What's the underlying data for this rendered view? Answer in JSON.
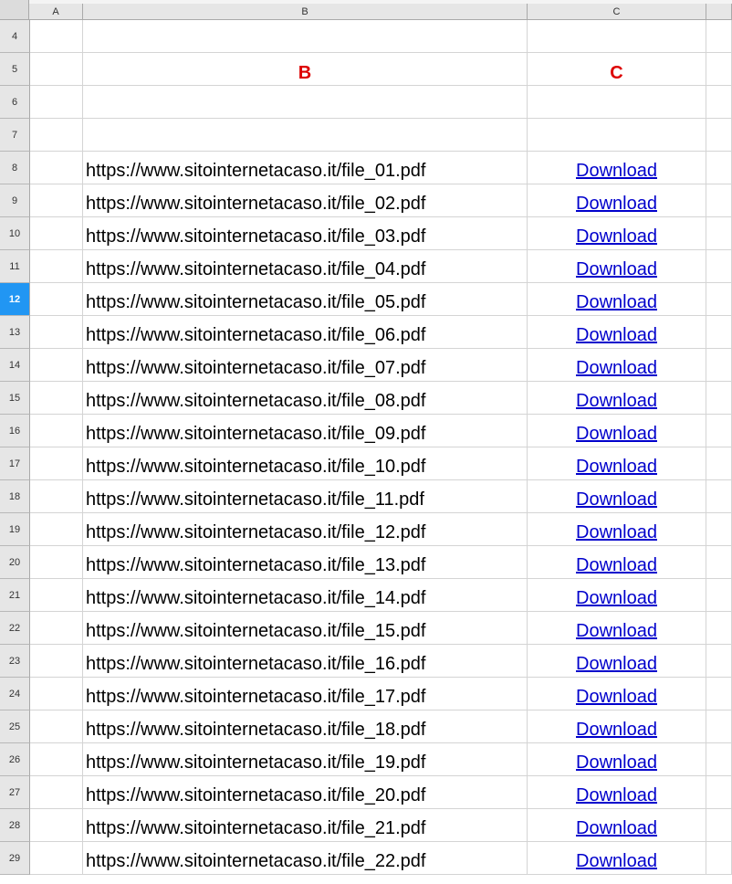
{
  "columns": [
    "A",
    "B",
    "C"
  ],
  "header_row": {
    "row": "5",
    "b": "B",
    "c": "C"
  },
  "empty_rows": [
    "4",
    "6",
    "7"
  ],
  "selected_row": "12",
  "rows": [
    {
      "row": "8",
      "url": "https://www.sitointernetacaso.it/file_01.pdf",
      "link": "Download"
    },
    {
      "row": "9",
      "url": "https://www.sitointernetacaso.it/file_02.pdf",
      "link": "Download"
    },
    {
      "row": "10",
      "url": "https://www.sitointernetacaso.it/file_03.pdf",
      "link": "Download"
    },
    {
      "row": "11",
      "url": "https://www.sitointernetacaso.it/file_04.pdf",
      "link": "Download"
    },
    {
      "row": "12",
      "url": "https://www.sitointernetacaso.it/file_05.pdf",
      "link": "Download"
    },
    {
      "row": "13",
      "url": "https://www.sitointernetacaso.it/file_06.pdf",
      "link": "Download"
    },
    {
      "row": "14",
      "url": "https://www.sitointernetacaso.it/file_07.pdf",
      "link": "Download"
    },
    {
      "row": "15",
      "url": "https://www.sitointernetacaso.it/file_08.pdf",
      "link": "Download"
    },
    {
      "row": "16",
      "url": "https://www.sitointernetacaso.it/file_09.pdf",
      "link": "Download"
    },
    {
      "row": "17",
      "url": "https://www.sitointernetacaso.it/file_10.pdf",
      "link": "Download"
    },
    {
      "row": "18",
      "url": "https://www.sitointernetacaso.it/file_11.pdf",
      "link": "Download"
    },
    {
      "row": "19",
      "url": "https://www.sitointernetacaso.it/file_12.pdf",
      "link": "Download"
    },
    {
      "row": "20",
      "url": "https://www.sitointernetacaso.it/file_13.pdf",
      "link": "Download"
    },
    {
      "row": "21",
      "url": "https://www.sitointernetacaso.it/file_14.pdf",
      "link": "Download"
    },
    {
      "row": "22",
      "url": "https://www.sitointernetacaso.it/file_15.pdf",
      "link": "Download"
    },
    {
      "row": "23",
      "url": "https://www.sitointernetacaso.it/file_16.pdf",
      "link": "Download"
    },
    {
      "row": "24",
      "url": "https://www.sitointernetacaso.it/file_17.pdf",
      "link": "Download"
    },
    {
      "row": "25",
      "url": "https://www.sitointernetacaso.it/file_18.pdf",
      "link": "Download"
    },
    {
      "row": "26",
      "url": "https://www.sitointernetacaso.it/file_19.pdf",
      "link": "Download"
    },
    {
      "row": "27",
      "url": "https://www.sitointernetacaso.it/file_20.pdf",
      "link": "Download"
    },
    {
      "row": "28",
      "url": "https://www.sitointernetacaso.it/file_21.pdf",
      "link": "Download"
    },
    {
      "row": "29",
      "url": "https://www.sitointernetacaso.it/file_22.pdf",
      "link": "Download"
    }
  ],
  "colors": {
    "selected_row_header": "#2196f3",
    "link": "#0000cc",
    "header_letters": "#dd0000"
  }
}
